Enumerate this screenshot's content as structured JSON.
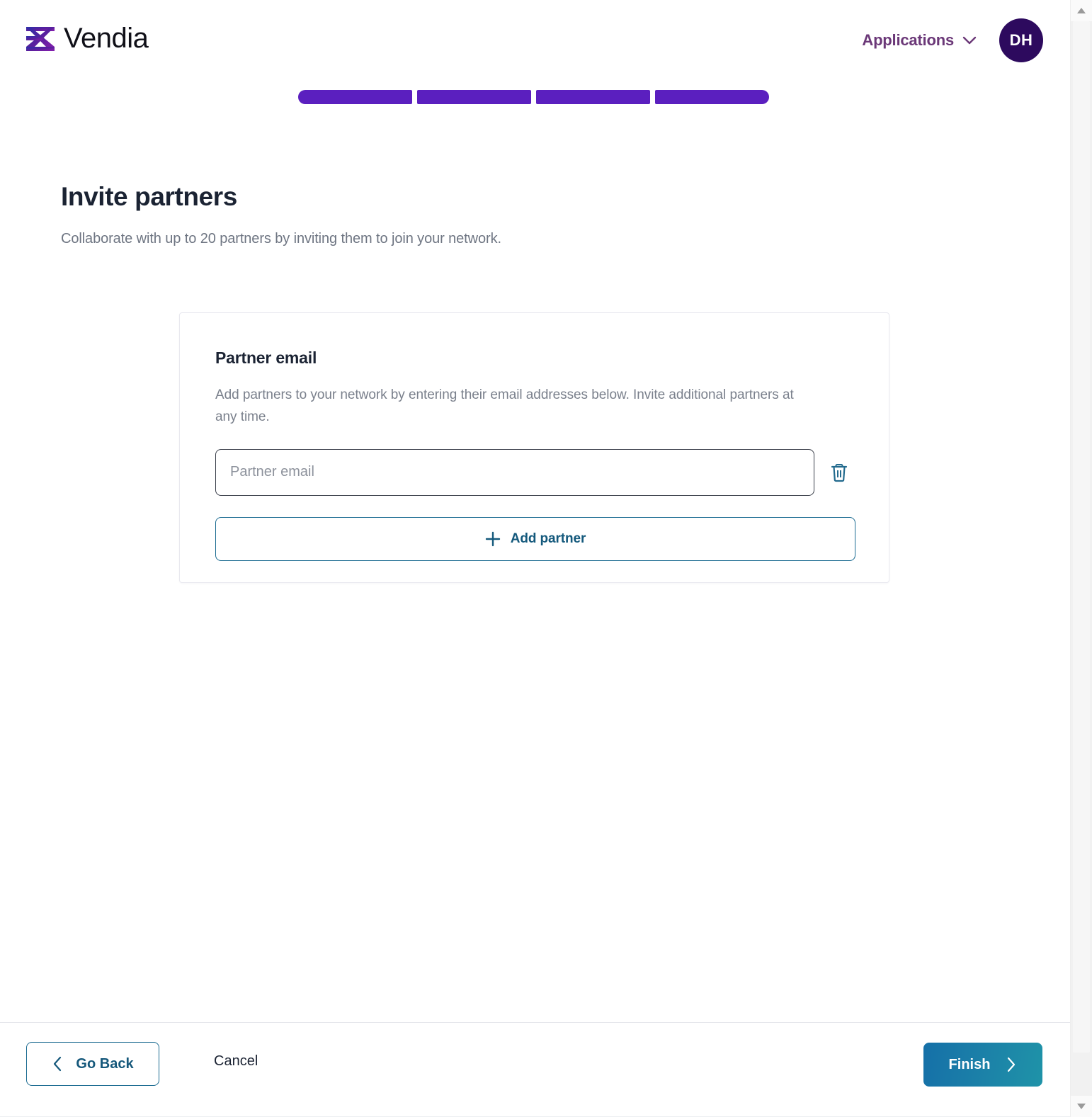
{
  "header": {
    "brand_name": "Vendia",
    "brand_mark_icon": "vendia-ribbon-logo",
    "applications_label": "Applications",
    "applications_chevron_icon": "chevron-down-icon",
    "avatar_initials": "DH",
    "avatar_color": "#2d0a5e",
    "applications_color": "#6b3878"
  },
  "stepper": {
    "total_steps": 4,
    "completed_steps": 4,
    "fill_color": "#5b1fbf",
    "steps": [
      {
        "index": 1,
        "state": "complete"
      },
      {
        "index": 2,
        "state": "complete"
      },
      {
        "index": 3,
        "state": "complete"
      },
      {
        "index": 4,
        "state": "complete"
      }
    ]
  },
  "page": {
    "title": "Invite partners",
    "subtitle": "Collaborate with up to 20 partners by inviting them to join your network."
  },
  "card": {
    "title": "Partner email",
    "description": "Add partners to your network by entering their email addresses below. Invite additional partners at any time.",
    "email_rows": [
      {
        "value": "",
        "placeholder": "Partner email",
        "delete_icon": "trash-icon"
      }
    ],
    "add_partner_label": "Add partner",
    "add_partner_icon": "plus-icon",
    "accent_color": "#1b6b91"
  },
  "footer": {
    "go_back_label": "Go Back",
    "go_back_icon": "chevron-left-icon",
    "cancel_label": "Cancel",
    "finish_label": "Finish",
    "finish_icon": "chevron-right-icon",
    "finish_gradient_from": "#1570a8",
    "finish_gradient_to": "#1f93a8"
  },
  "scrollbar": {
    "up_icon": "scroll-up-arrow-icon",
    "down_icon": "scroll-down-arrow-icon"
  }
}
